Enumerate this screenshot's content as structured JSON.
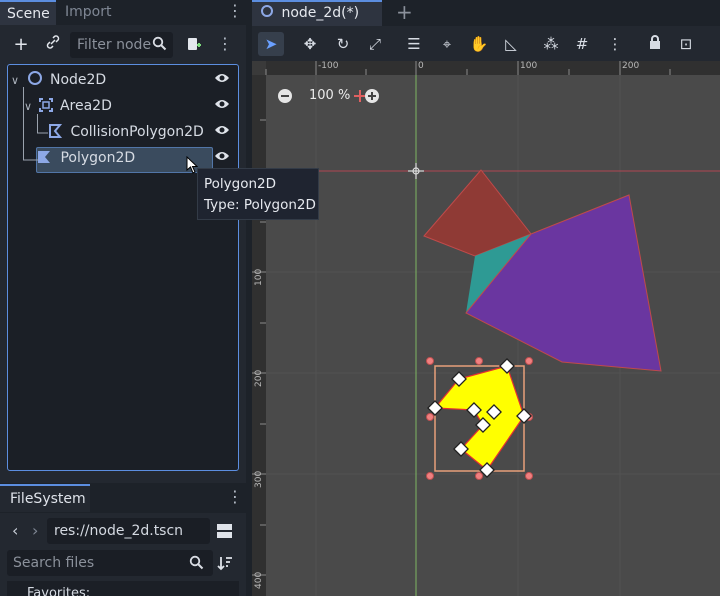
{
  "scene_dock": {
    "tabs": [
      {
        "label": "Scene"
      },
      {
        "label": "Import"
      }
    ],
    "filter_placeholder": "Filter node",
    "tree": [
      {
        "label": "Node2D",
        "icon": "node2d-icon"
      },
      {
        "label": "Area2D",
        "icon": "area2d-icon"
      },
      {
        "label": "CollisionPolygon2D",
        "icon": "collision-polygon-icon"
      },
      {
        "label": "Polygon2D",
        "icon": "polygon2d-icon",
        "selected": true
      }
    ]
  },
  "tooltip": {
    "line1": "Polygon2D",
    "line2": "Type: Polygon2D"
  },
  "filesystem": {
    "tab": "FileSystem",
    "path": "res://node_2d.tscn",
    "search_placeholder": "Search files",
    "favorites_label": "Favorites:"
  },
  "editor": {
    "scene_tab": "node_2d(*)",
    "zoom": "100 %"
  },
  "ruler": {
    "x_labels": [
      "-100",
      "0",
      "100",
      "200"
    ],
    "y_labels": [
      "0",
      "100",
      "200",
      "300",
      "400"
    ]
  },
  "colors": {
    "accent": "#5c8ee0",
    "viewport_bg": "#4a4a4a",
    "polygon_red": "#8f3a35",
    "polygon_teal": "#2e9a94",
    "polygon_purple": "#6a36a0",
    "polygon_yellow": "#ffff00"
  }
}
